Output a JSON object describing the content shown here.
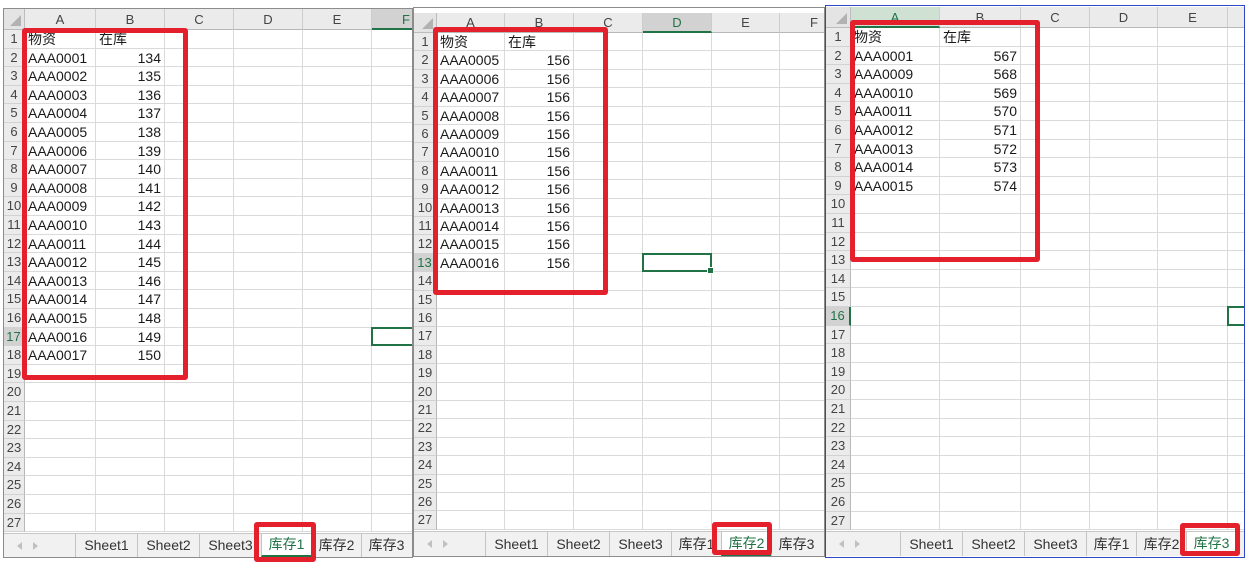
{
  "panels": [
    {
      "columns": [
        "A",
        "B",
        "C",
        "D",
        "E",
        "F"
      ],
      "row_numbers": [
        1,
        2,
        3,
        4,
        5,
        6,
        7,
        8,
        9,
        10,
        11,
        12,
        13,
        14,
        15,
        16,
        17,
        18,
        19,
        20,
        21,
        22,
        23,
        24,
        25,
        26,
        27
      ],
      "cells": [
        [
          "物资",
          "在库"
        ],
        [
          "AAA0001",
          134
        ],
        [
          "AAA0002",
          135
        ],
        [
          "AAA0003",
          136
        ],
        [
          "AAA0004",
          137
        ],
        [
          "AAA0005",
          138
        ],
        [
          "AAA0006",
          139
        ],
        [
          "AAA0007",
          140
        ],
        [
          "AAA0008",
          141
        ],
        [
          "AAA0009",
          142
        ],
        [
          "AAA0010",
          143
        ],
        [
          "AAA0011",
          144
        ],
        [
          "AAA0012",
          145
        ],
        [
          "AAA0013",
          146
        ],
        [
          "AAA0014",
          147
        ],
        [
          "AAA0015",
          148
        ],
        [
          "AAA0016",
          149
        ],
        [
          "AAA0017",
          150
        ]
      ],
      "sheet_tabs": [
        "Sheet1",
        "Sheet2",
        "Sheet3",
        "库存1",
        "库存2",
        "库存3"
      ],
      "active_tab_index": 3
    },
    {
      "columns": [
        "A",
        "B",
        "C",
        "D",
        "E",
        "F"
      ],
      "row_numbers": [
        1,
        2,
        3,
        4,
        5,
        6,
        7,
        8,
        9,
        10,
        11,
        12,
        13,
        14,
        15,
        16,
        17,
        18,
        19,
        20,
        21,
        22,
        23,
        24,
        25,
        26,
        27
      ],
      "cells": [
        [
          "物资",
          "在库"
        ],
        [
          "AAA0005",
          156
        ],
        [
          "AAA0006",
          156
        ],
        [
          "AAA0007",
          156
        ],
        [
          "AAA0008",
          156
        ],
        [
          "AAA0009",
          156
        ],
        [
          "AAA0010",
          156
        ],
        [
          "AAA0011",
          156
        ],
        [
          "AAA0012",
          156
        ],
        [
          "AAA0013",
          156
        ],
        [
          "AAA0014",
          156
        ],
        [
          "AAA0015",
          156
        ],
        [
          "AAA0016",
          156
        ]
      ],
      "sheet_tabs": [
        "Sheet1",
        "Sheet2",
        "Sheet3",
        "库存1",
        "库存2",
        "库存3"
      ],
      "active_tab_index": 4
    },
    {
      "columns": [
        "A",
        "B",
        "C",
        "D",
        "E"
      ],
      "row_numbers": [
        1,
        2,
        3,
        4,
        5,
        6,
        7,
        8,
        9,
        10,
        11,
        12,
        13,
        14,
        15,
        16,
        17,
        18,
        19,
        20,
        21,
        22,
        23,
        24,
        25,
        26,
        27
      ],
      "cells": [
        [
          "物资",
          "在库"
        ],
        [
          "AAA0001",
          567
        ],
        [
          "AAA0009",
          568
        ],
        [
          "AAA0010",
          569
        ],
        [
          "AAA0011",
          570
        ],
        [
          "AAA0012",
          571
        ],
        [
          "AAA0013",
          572
        ],
        [
          "AAA0014",
          573
        ],
        [
          "AAA0015",
          574
        ]
      ],
      "sheet_tabs": [
        "Sheet1",
        "Sheet2",
        "Sheet3",
        "库存1",
        "库存2",
        "库存3"
      ],
      "active_tab_index": 5
    }
  ],
  "icons": {
    "select_all": "select-all-triangle-icon",
    "tab_scroll_prev": "tab-scroll-left-icon",
    "tab_scroll_next": "tab-scroll-right-icon"
  },
  "colors": {
    "accent_green": "#217346",
    "annotation_red": "#e3202b",
    "panel_frame": "#8c8c8c",
    "panel_frame_focus": "#3246c8"
  }
}
